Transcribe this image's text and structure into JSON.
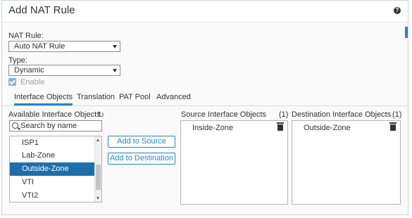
{
  "dialog": {
    "title": "Add NAT Rule",
    "help_icon": "?"
  },
  "form": {
    "nat_rule_label": "NAT Rule:",
    "nat_rule_value": "Auto NAT Rule",
    "type_label": "Type:",
    "type_value": "Dynamic",
    "enable_label": "Enable",
    "enable_checked": true
  },
  "tabs": [
    {
      "label": "Interface Objects",
      "active": true
    },
    {
      "label": "Translation",
      "active": false
    },
    {
      "label": "PAT Pool",
      "active": false
    },
    {
      "label": "Advanced",
      "active": false
    }
  ],
  "available": {
    "label": "Available Interface Objects",
    "refresh_icon": "refresh-icon",
    "search_placeholder": "Search by name",
    "items": [
      {
        "label": "ISP1",
        "selected": false
      },
      {
        "label": "Lab-Zone",
        "selected": false
      },
      {
        "label": "Outside-Zone",
        "selected": true
      },
      {
        "label": "VTI",
        "selected": false
      },
      {
        "label": "VTI2",
        "selected": false
      }
    ]
  },
  "buttons": {
    "add_source": "Add to Source",
    "add_destination": "Add to Destination"
  },
  "source": {
    "label": "Source Interface Objects",
    "count": "(1)",
    "items": [
      "Inside-Zone"
    ]
  },
  "destination": {
    "label": "Destination Interface Objects",
    "count": "(1)",
    "items": [
      "Outside-Zone"
    ]
  },
  "colors": {
    "accent": "#1e87c8",
    "selected_row": "#1b6fac",
    "checkbox": "#7fb7de"
  }
}
